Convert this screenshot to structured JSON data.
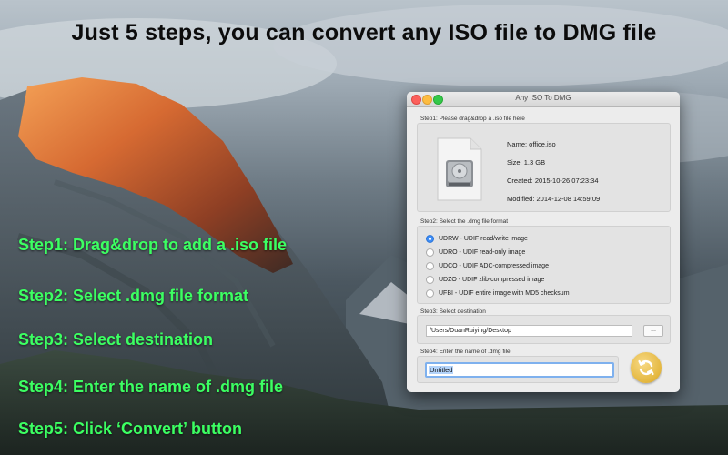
{
  "headline": "Just 5 steps, you can convert any ISO file to DMG file",
  "steps": [
    "Step1:  Drag&drop to add a .iso file",
    "Step2:  Select .dmg file format",
    "Step3:  Select destination",
    "Step4:  Enter the name of .dmg file",
    "Step5:  Click ‘Convert’ button"
  ],
  "window": {
    "title": "Any ISO To DMG",
    "step1": {
      "label": "Step1: Please drag&drop a .iso file here",
      "name": "Name: office.iso",
      "size": "Size: 1.3 GB",
      "created": "Created: 2015-10-26 07:23:34",
      "modified": "Modified: 2014-12-08 14:59:09"
    },
    "step2": {
      "label": "Step2: Select the .dmg file format",
      "options": [
        "UDRW - UDIF read/write image",
        "UDRO - UDIF read-only image",
        "UDCO - UDIF ADC-compressed image",
        "UDZO - UDIF zlib-compressed image",
        "UFBI - UDIF entire image with MD5 checksum"
      ],
      "selected_index": 0
    },
    "step3": {
      "label": "Step3: Select destination",
      "path": "/Users/DuanRuiying/Desktop",
      "browse": "..."
    },
    "step4": {
      "label": "Step4: Enter the name of .dmg file",
      "name_value": "Untitled"
    }
  },
  "colors": {
    "step_text": "#3cff62",
    "accent": "#3e8ef7",
    "convert_button": "#e4b73f"
  }
}
